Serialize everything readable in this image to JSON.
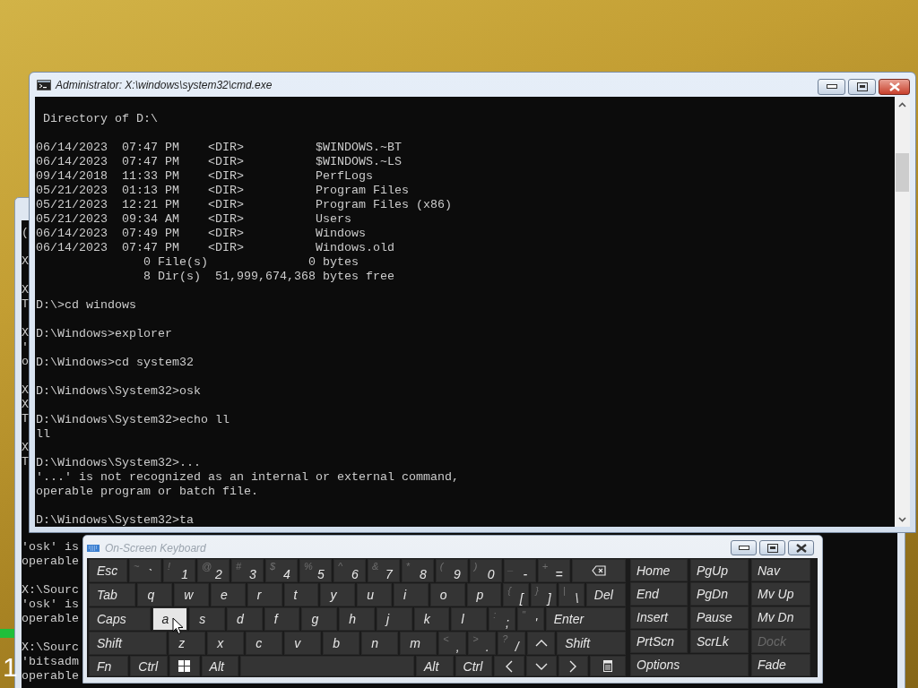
{
  "desktop": {
    "marker": "1"
  },
  "background_console": {
    "top_blocks": [
      [
        "("
      ],
      [
        "X"
      ],
      [
        "X",
        "T"
      ],
      [
        "X",
        "'",
        "o"
      ],
      [
        "X",
        "X",
        "T"
      ],
      [
        "X",
        "T"
      ]
    ],
    "bottom_blocks": [
      [
        "'osk' is",
        "operable"
      ],
      [
        "X:\\Sourc",
        "'osk' is",
        "operable"
      ],
      [
        "X:\\Sourc",
        "'bitsadm",
        "operable"
      ]
    ]
  },
  "cmd_window": {
    "title": "Administrator: X:\\windows\\system32\\cmd.exe",
    "blocks": [
      [
        " Directory of D:\\"
      ],
      [
        "06/14/2023  07:47 PM    <DIR>          $WINDOWS.~BT",
        "06/14/2023  07:47 PM    <DIR>          $WINDOWS.~LS",
        "09/14/2018  11:33 PM    <DIR>          PerfLogs",
        "05/21/2023  01:13 PM    <DIR>          Program Files",
        "05/21/2023  12:21 PM    <DIR>          Program Files (x86)",
        "05/21/2023  09:34 AM    <DIR>          Users",
        "06/14/2023  07:49 PM    <DIR>          Windows",
        "06/14/2023  07:47 PM    <DIR>          Windows.old",
        "               0 File(s)              0 bytes",
        "               8 Dir(s)  51,999,674,368 bytes free"
      ],
      [
        "D:\\>cd windows"
      ],
      [
        "D:\\Windows>explorer"
      ],
      [
        "D:\\Windows>cd system32"
      ],
      [
        "D:\\Windows\\System32>osk"
      ],
      [
        "D:\\Windows\\System32>echo ll",
        "ll"
      ],
      [
        "D:\\Windows\\System32>...",
        "'...' is not recognized as an internal or external command,",
        "operable program or batch file."
      ],
      [
        "D:\\Windows\\System32>ta"
      ]
    ]
  },
  "keyboard": {
    "title": "On-Screen Keyboard",
    "main_rows": [
      [
        {
          "kind": "text",
          "label": "Esc",
          "hovered": false
        },
        {
          "kind": "char",
          "shift": "~",
          "label": "`",
          "hovered": false
        },
        {
          "kind": "char",
          "shift": "!",
          "label": "1",
          "hovered": false
        },
        {
          "kind": "char",
          "shift": "@",
          "label": "2",
          "hovered": false
        },
        {
          "kind": "char",
          "shift": "#",
          "label": "3",
          "hovered": false
        },
        {
          "kind": "char",
          "shift": "$",
          "label": "4",
          "hovered": false
        },
        {
          "kind": "char",
          "shift": "%",
          "label": "5",
          "hovered": false
        },
        {
          "kind": "char",
          "shift": "^",
          "label": "6",
          "hovered": false
        },
        {
          "kind": "char",
          "shift": "&",
          "label": "7",
          "hovered": false
        },
        {
          "kind": "char",
          "shift": "*",
          "label": "8",
          "hovered": false
        },
        {
          "kind": "char",
          "shift": "(",
          "label": "9",
          "hovered": false
        },
        {
          "kind": "char",
          "shift": ")",
          "label": "0",
          "hovered": false
        },
        {
          "kind": "char",
          "shift": "_",
          "label": "-",
          "hovered": false
        },
        {
          "kind": "char",
          "shift": "+",
          "label": "=",
          "hovered": false
        },
        {
          "kind": "backspace",
          "hovered": false
        }
      ],
      [
        {
          "kind": "text",
          "label": "Tab",
          "hovered": false
        },
        {
          "kind": "char",
          "label": "q",
          "hovered": false
        },
        {
          "kind": "char",
          "label": "w",
          "hovered": false
        },
        {
          "kind": "char",
          "label": "e",
          "hovered": false
        },
        {
          "kind": "char",
          "label": "r",
          "hovered": false
        },
        {
          "kind": "char",
          "label": "t",
          "hovered": false
        },
        {
          "kind": "char",
          "label": "y",
          "hovered": false
        },
        {
          "kind": "char",
          "label": "u",
          "hovered": false
        },
        {
          "kind": "char",
          "label": "i",
          "hovered": false
        },
        {
          "kind": "char",
          "label": "o",
          "hovered": false
        },
        {
          "kind": "char",
          "label": "p",
          "hovered": false
        },
        {
          "kind": "char",
          "shift": "{",
          "label": "[",
          "hovered": false
        },
        {
          "kind": "char",
          "shift": "}",
          "label": "]",
          "hovered": false
        },
        {
          "kind": "char",
          "shift": "|",
          "label": "\\",
          "hovered": false
        },
        {
          "kind": "text",
          "label": "Del",
          "hovered": false
        }
      ],
      [
        {
          "kind": "text",
          "label": "Caps",
          "hovered": false
        },
        {
          "kind": "char",
          "label": "a",
          "hovered": true
        },
        {
          "kind": "char",
          "label": "s",
          "hovered": false
        },
        {
          "kind": "char",
          "label": "d",
          "hovered": false
        },
        {
          "kind": "char",
          "label": "f",
          "hovered": false
        },
        {
          "kind": "char",
          "label": "g",
          "hovered": false
        },
        {
          "kind": "char",
          "label": "h",
          "hovered": false
        },
        {
          "kind": "char",
          "label": "j",
          "hovered": false
        },
        {
          "kind": "char",
          "label": "k",
          "hovered": false
        },
        {
          "kind": "char",
          "label": "l",
          "hovered": false
        },
        {
          "kind": "char",
          "shift": ":",
          "label": ";",
          "hovered": false
        },
        {
          "kind": "char",
          "shift": "\"",
          "label": "'",
          "hovered": false
        },
        {
          "kind": "text",
          "label": "Enter",
          "hovered": false
        }
      ],
      [
        {
          "kind": "text",
          "label": "Shift",
          "hovered": false
        },
        {
          "kind": "char",
          "label": "z",
          "hovered": false
        },
        {
          "kind": "char",
          "label": "x",
          "hovered": false
        },
        {
          "kind": "char",
          "label": "c",
          "hovered": false
        },
        {
          "kind": "char",
          "label": "v",
          "hovered": false
        },
        {
          "kind": "char",
          "label": "b",
          "hovered": false
        },
        {
          "kind": "char",
          "label": "n",
          "hovered": false
        },
        {
          "kind": "char",
          "label": "m",
          "hovered": false
        },
        {
          "kind": "char",
          "shift": "<",
          "label": ",",
          "hovered": false
        },
        {
          "kind": "char",
          "shift": ">",
          "label": ".",
          "hovered": false
        },
        {
          "kind": "char",
          "shift": "?",
          "label": "/",
          "hovered": false
        },
        {
          "kind": "up",
          "hovered": false
        },
        {
          "kind": "text",
          "label": "Shift",
          "hovered": false
        }
      ],
      [
        {
          "kind": "text",
          "label": "Fn",
          "hovered": false
        },
        {
          "kind": "text",
          "label": "Ctrl",
          "hovered": false
        },
        {
          "kind": "windows",
          "hovered": false
        },
        {
          "kind": "text",
          "label": "Alt",
          "hovered": false
        },
        {
          "kind": "space",
          "hovered": false
        },
        {
          "kind": "text",
          "label": "Alt",
          "hovered": false
        },
        {
          "kind": "text",
          "label": "Ctrl",
          "hovered": false
        },
        {
          "kind": "left",
          "hovered": false
        },
        {
          "kind": "down",
          "hovered": false
        },
        {
          "kind": "right",
          "hovered": false
        },
        {
          "kind": "menu",
          "hovered": false
        }
      ]
    ],
    "side_keys": [
      {
        "label": "Home",
        "disabled": false
      },
      {
        "label": "PgUp",
        "disabled": false
      },
      {
        "label": "Nav",
        "disabled": false
      },
      {
        "label": "End",
        "disabled": false
      },
      {
        "label": "PgDn",
        "disabled": false
      },
      {
        "label": "Mv Up",
        "disabled": false
      },
      {
        "label": "Insert",
        "disabled": false
      },
      {
        "label": "Pause",
        "disabled": false
      },
      {
        "label": "Mv Dn",
        "disabled": false
      },
      {
        "label": "PrtScn",
        "disabled": false
      },
      {
        "label": "ScrLk",
        "disabled": false
      },
      {
        "label": "Dock",
        "disabled": true
      },
      {
        "label": "Options",
        "disabled": false,
        "kind": "wide"
      },
      {
        "label": "Fade",
        "disabled": false
      }
    ]
  }
}
